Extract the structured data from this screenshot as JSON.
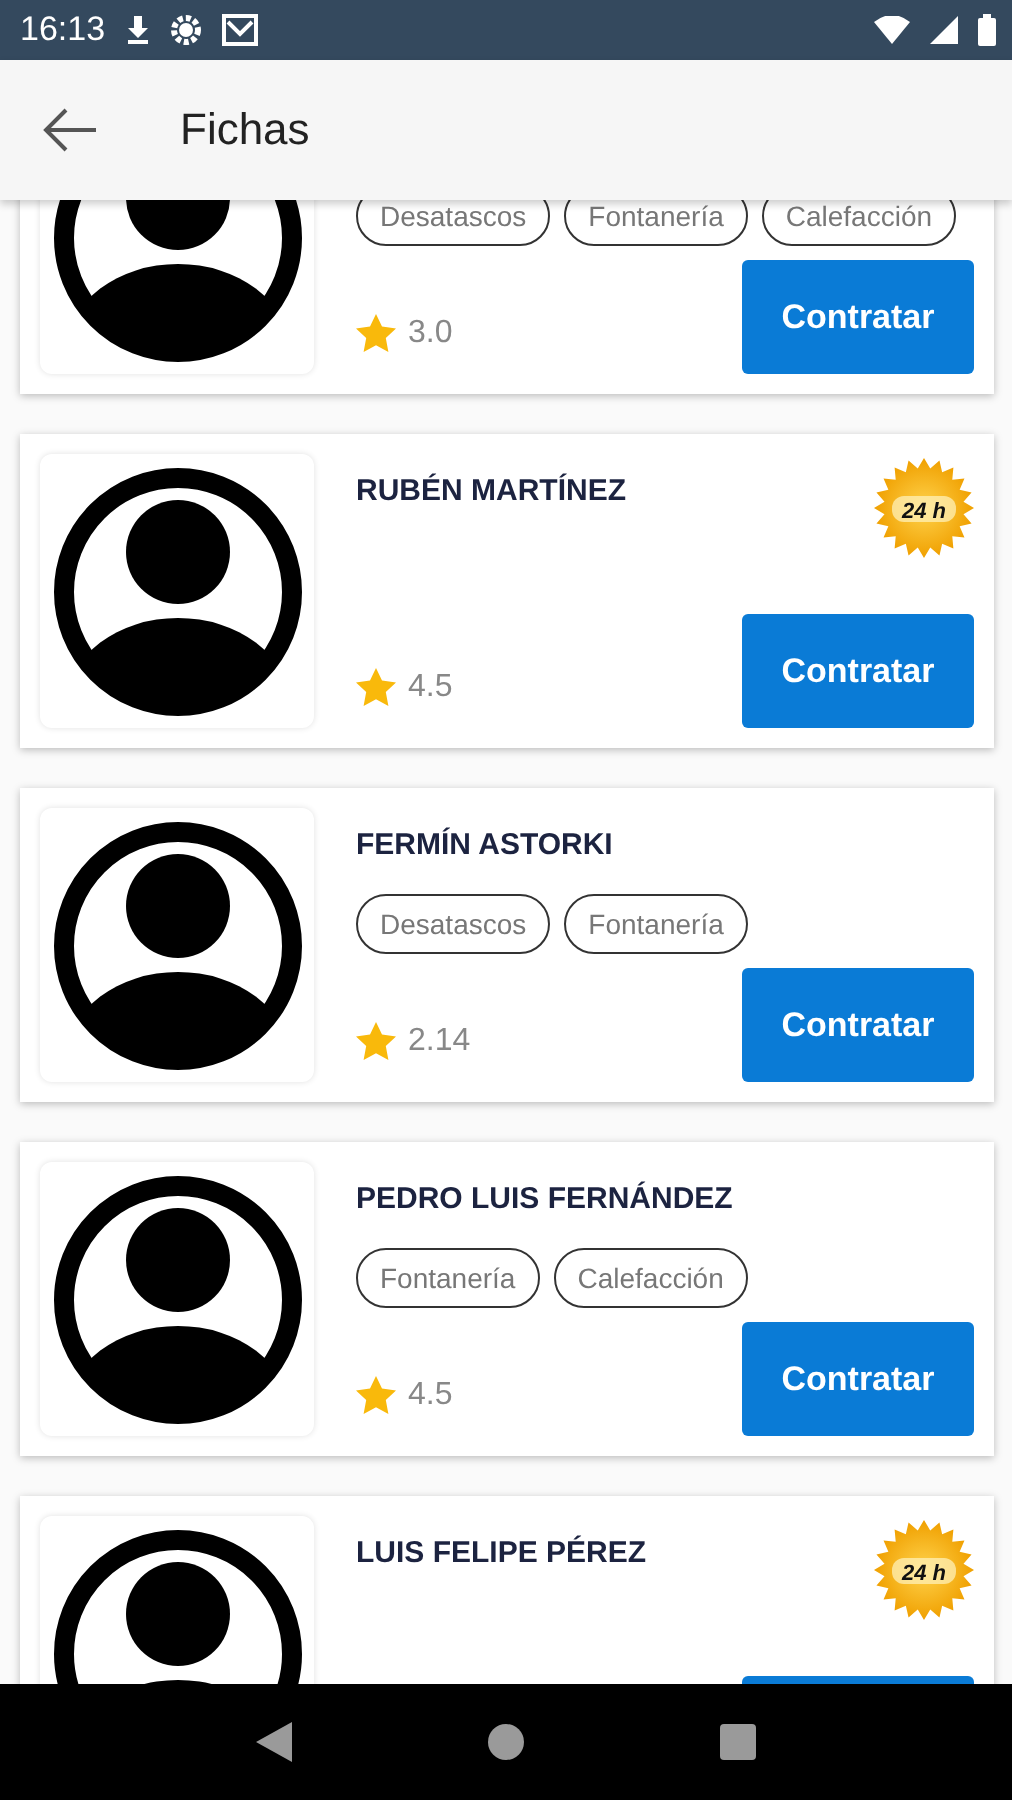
{
  "status_bar": {
    "time": "16:13"
  },
  "app_bar": {
    "title": "Fichas"
  },
  "cards": [
    {
      "tags": [
        "Desatascos",
        "Fontanería",
        "Calefacción"
      ],
      "rating": "3.0",
      "button": "Contratar"
    },
    {
      "name": "RUBÉN MARTÍNEZ",
      "badge": "24 h",
      "rating": "4.5",
      "button": "Contratar"
    },
    {
      "name": "FERMÍN ASTORKI",
      "tags": [
        "Desatascos",
        "Fontanería"
      ],
      "rating": "2.14",
      "button": "Contratar"
    },
    {
      "name": "PEDRO LUIS FERNÁNDEZ",
      "tags": [
        "Fontanería",
        "Calefacción"
      ],
      "rating": "4.5",
      "button": "Contratar"
    },
    {
      "name": "LUIS FELIPE PÉREZ",
      "badge": "24 h"
    }
  ]
}
